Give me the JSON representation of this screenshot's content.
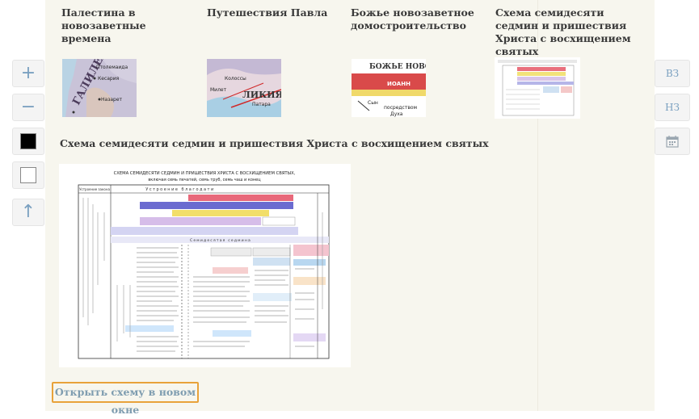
{
  "thumbnails": [
    {
      "title": "Палестина в новозаветные времена",
      "map_words": [
        "ГАЛИЛЕЯ",
        "Птолемаида",
        "Кесария",
        "Назарет"
      ]
    },
    {
      "title": "Путешествия Павла",
      "map_words": [
        "ЛИКИЯ",
        "Колоссы",
        "Милет",
        "Патара"
      ]
    },
    {
      "title": "Божье новозаветное домостроительство",
      "map_words": [
        "БОЖЬЕ НОВО",
        "ИОАНН",
        "Сын",
        "посредством",
        "Духа"
      ]
    },
    {
      "title": "Схема семидесяти седмин и пришествия Христа с восхищением святых"
    }
  ],
  "section_title": "Схема семидесяти седмин и пришествия Христа с восхищением святых",
  "scheme": {
    "heading_line1": "СХЕМА СЕМИДЕСЯТИ СЕДМИН И ПРИШЕСТВИЯ ХРИСТА С ВОСХИЩЕНИЕМ СВЯТЫХ,",
    "heading_line2": "включая семь печатей, семь труб, семь чаш и конец",
    "col_label": "Устроение закона",
    "band_label": "Устроение благодати",
    "row_label": "Семидесятая седмина"
  },
  "open_button": "Открыть схему в новом окне",
  "left_controls": [
    {
      "name": "zoom-in-button",
      "glyph": "+"
    },
    {
      "name": "zoom-out-button",
      "glyph": "−"
    },
    {
      "name": "black-theme-button",
      "swatch": "#000000"
    },
    {
      "name": "white-theme-button",
      "swatch": "#ffffff"
    },
    {
      "name": "scroll-top-button",
      "glyph": "↑"
    }
  ],
  "right_controls": [
    "ВЗ",
    "НЗ"
  ],
  "colors": {
    "accent_blue": "#7aa0c0",
    "button_border_orange": "#e8a23a",
    "panel_bg": "#f7f6ee"
  }
}
